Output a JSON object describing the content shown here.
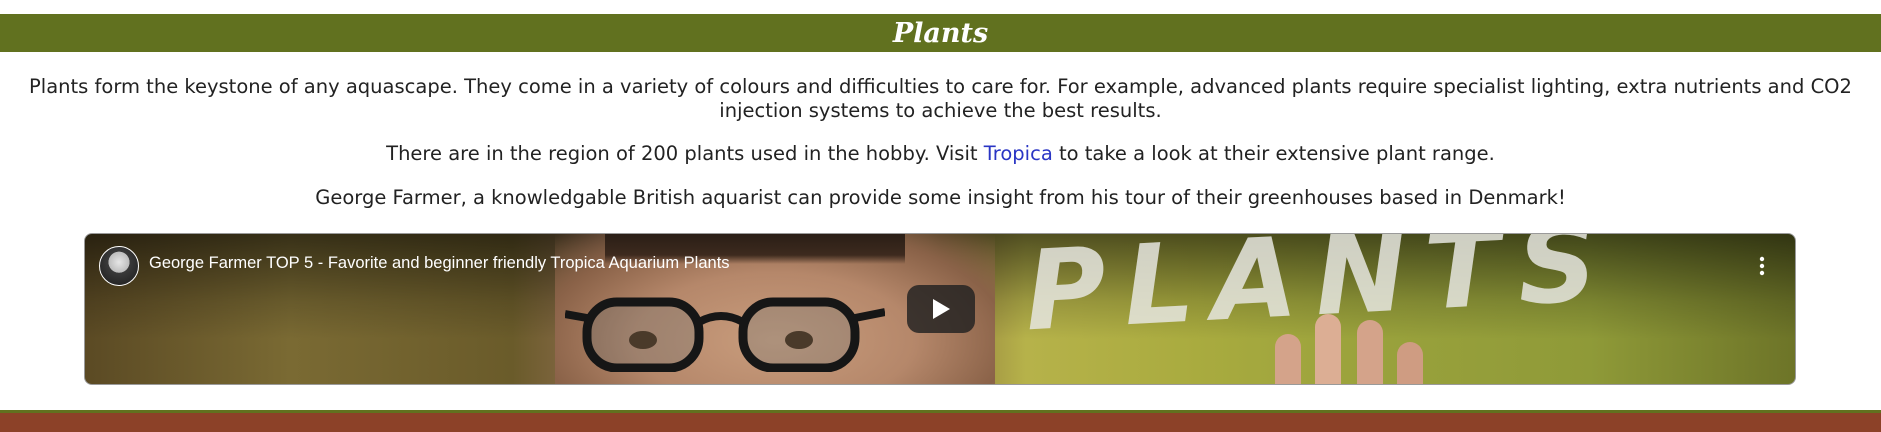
{
  "header": {
    "title": "Plants"
  },
  "content": {
    "paragraph_1": "Plants form the keystone of any aquascape. They come in a variety of colours and difficulties to care for. For example, advanced plants require specialist lighting, extra nutrients and CO2 injection systems to achieve the best results.",
    "paragraph_2_before": "There are in the region of 200 plants used in the hobby. Visit ",
    "paragraph_2_link": "Tropica",
    "paragraph_2_after": " to take a look at their extensive plant range.",
    "paragraph_3": "George Farmer, a knowledgable British aquarist can provide some insight from his tour of their greenhouses based in Denmark!"
  },
  "video": {
    "title": "George Farmer TOP 5 - Favorite and beginner friendly Tropica Aquarium Plants",
    "thumbnail_text": "PLANTS",
    "channel_avatar_icon": "channel-avatar",
    "menu_icon": "more-vert-icon",
    "play_icon": "play-icon"
  },
  "colors": {
    "header_green": "#61711f",
    "footer_brown": "#8c4128",
    "link_blue": "#2a35c4",
    "text_dark": "#222222"
  }
}
